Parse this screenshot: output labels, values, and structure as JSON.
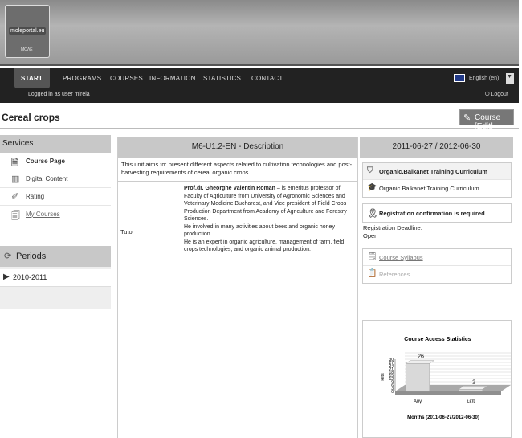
{
  "logo": {
    "text": "moleportal.eu",
    "sub": "ΜΟΛΕ"
  },
  "nav": {
    "items": [
      "START",
      "PROGRAMS",
      "COURSES",
      "INFORMATION",
      "STATISTICS",
      "CONTACT"
    ],
    "language": "English (en)",
    "logged_in": "Logged in as user mirela",
    "logout": "Logout"
  },
  "page": {
    "title": "Cereal crops",
    "course_button": "Course [Edit]"
  },
  "sidebar": {
    "services_title": "Services",
    "items": [
      {
        "label": "Course Page",
        "icon": "page-icon"
      },
      {
        "label": "Digital Content",
        "icon": "book-icon"
      },
      {
        "label": "Rating",
        "icon": "rating-icon"
      },
      {
        "label": "My Courses",
        "icon": "courses-icon"
      }
    ],
    "periods_title": "Periods",
    "period_item": "2010-2011"
  },
  "main": {
    "header": "M6-U1.2-EN - Description",
    "aims": "This unit aims to: present different aspects related to cultivation technologies and post-harvesting requirements of cereal organic crops.",
    "tutor_label": "Tutor",
    "tutor_name": "Prof.dr. Gheorghe Valentin Roman",
    "tutor_bio": " – is emeritus professor of Faculty of Agriculture from University of Agronomic Sciences and Veterinary Medicine Bucharest, and Vice president of Field Crops Production Department from Academy of Agriculture and Forestry Sciences.",
    "tutor_p2": "He involved in many activities about bees and organic honey production.",
    "tutor_p3": "He is an expert in organic agriculture, management of farm, field crops technologies, and organic animal production."
  },
  "right": {
    "date_range": "2011-06-27 / 2012-06-30",
    "curriculum_title": "Organic.Balkanet Training Curriculum",
    "curriculum_item": "Organic.Balkanet Training Curriculum",
    "registration_title": "Registration confirmation is required",
    "deadline_label": "Registration Deadline:",
    "deadline_value": "Open",
    "syllabus": "Course Syllabus",
    "references": "References"
  },
  "chart_data": {
    "type": "bar",
    "title": "Course Access Statistics",
    "xlabel": "Months (2011-06-27/2012-06-30)",
    "ylabel": "Hits",
    "categories": [
      "Αυγ",
      "Σεπ"
    ],
    "values": [
      26,
      2
    ],
    "ylim": [
      0,
      30
    ],
    "ticks": [
      "30",
      "27",
      "24",
      "21",
      "18",
      "15",
      "12",
      "9",
      "6",
      "3",
      "0"
    ],
    "colors": {
      "bar": "#d9d9d9",
      "floor": "#a9a9a9",
      "grid": "#cccccc"
    }
  }
}
